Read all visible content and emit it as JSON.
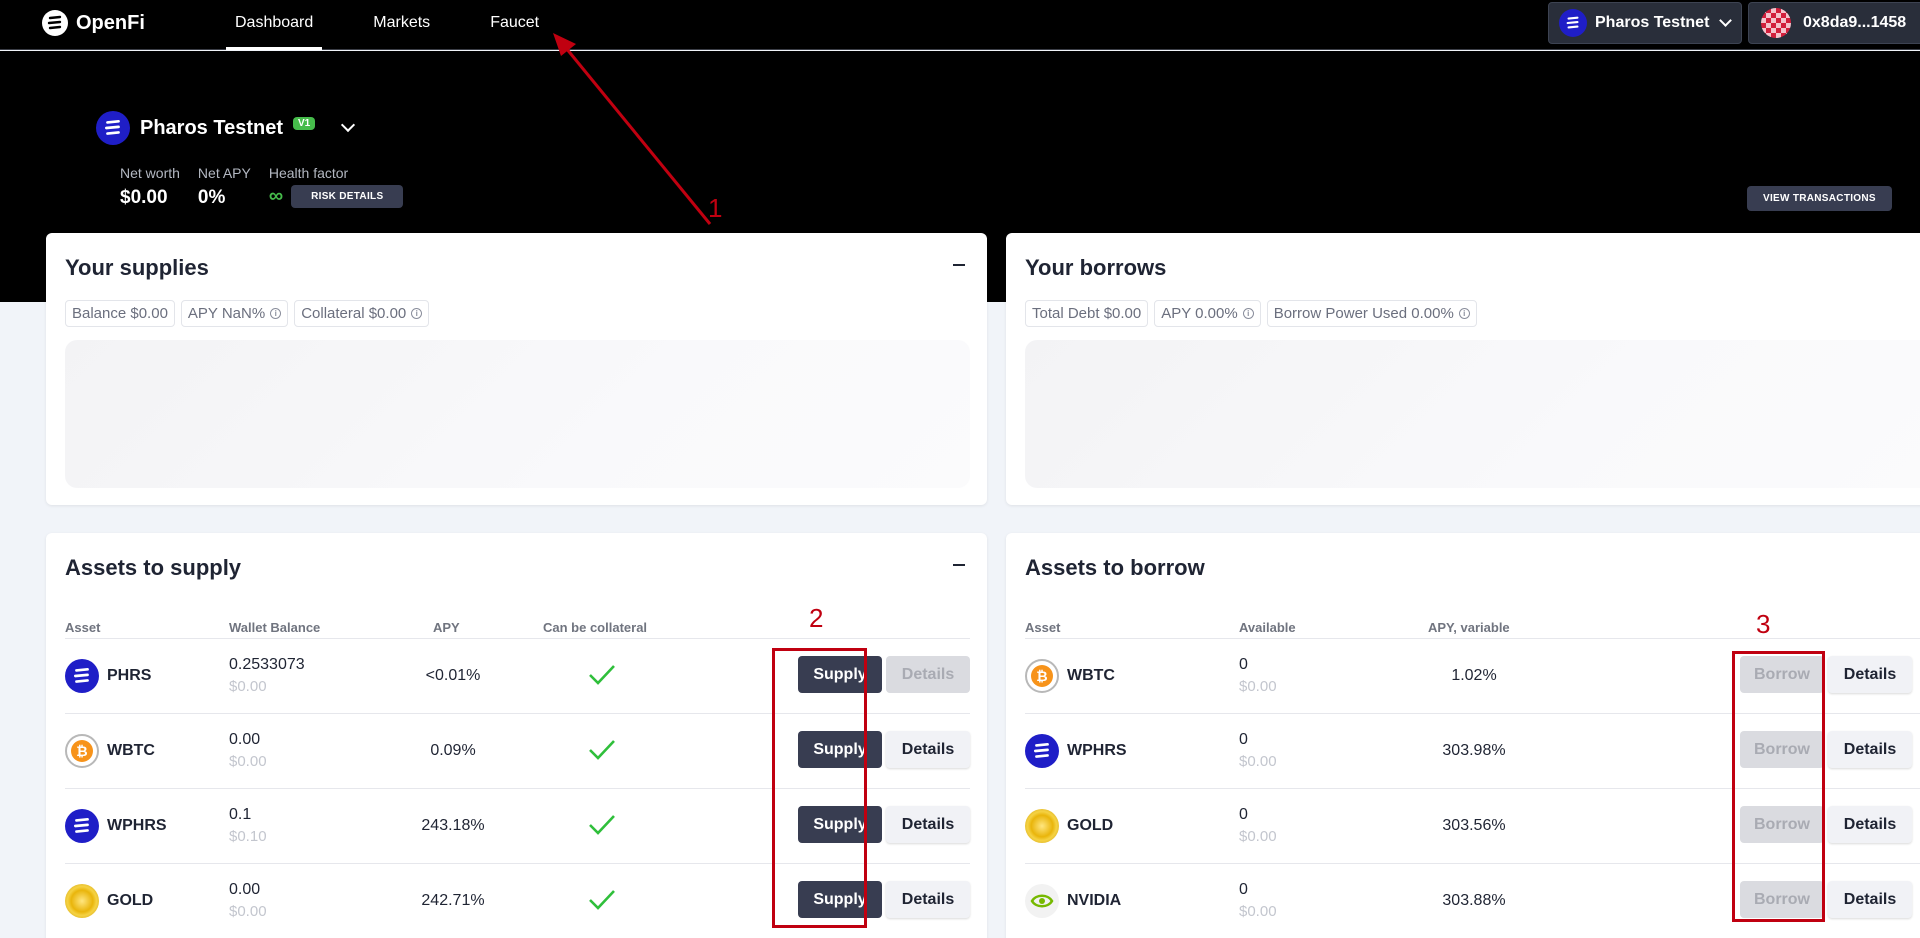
{
  "app": {
    "name": "OpenFi"
  },
  "nav": {
    "dashboard": "Dashboard",
    "markets": "Markets",
    "faucet": "Faucet"
  },
  "header": {
    "network": "Pharos Testnet",
    "wallet": "0x8da9...1458"
  },
  "hero": {
    "network": "Pharos Testnet",
    "version": "V1",
    "net_worth_label": "Net worth",
    "net_worth": "$0.00",
    "net_apy_label": "Net APY",
    "net_apy": "0%",
    "health_label": "Health factor",
    "health_value": "∞",
    "risk_button": "RISK DETAILS",
    "view_transactions": "VIEW TRANSACTIONS"
  },
  "supplies": {
    "title": "Your supplies",
    "chips": [
      "Balance $0.00",
      "APY NaN%",
      "Collateral $0.00"
    ]
  },
  "borrows": {
    "title": "Your borrows",
    "chips": [
      "Total Debt $0.00",
      "APY 0.00%",
      "Borrow Power Used 0.00%"
    ]
  },
  "assets_supply": {
    "title": "Assets to supply",
    "headers": {
      "asset": "Asset",
      "balance": "Wallet Balance",
      "apy": "APY",
      "collateral": "Can be collateral"
    },
    "supply_label": "Supply",
    "details_label": "Details",
    "rows": [
      {
        "asset": "PHRS",
        "balance": "0.2533073",
        "usd": "$0.00",
        "apy": "<0.01%"
      },
      {
        "asset": "WBTC",
        "balance": "0.00",
        "usd": "$0.00",
        "apy": "0.09%"
      },
      {
        "asset": "WPHRS",
        "balance": "0.1",
        "usd": "$0.10",
        "apy": "243.18%"
      },
      {
        "asset": "GOLD",
        "balance": "0.00",
        "usd": "$0.00",
        "apy": "242.71%"
      }
    ]
  },
  "assets_borrow": {
    "title": "Assets to borrow",
    "headers": {
      "asset": "Asset",
      "available": "Available",
      "apy": "APY, variable"
    },
    "borrow_label": "Borrow",
    "details_label": "Details",
    "rows": [
      {
        "asset": "WBTC",
        "available": "0",
        "usd": "$0.00",
        "apy": "1.02%"
      },
      {
        "asset": "WPHRS",
        "available": "0",
        "usd": "$0.00",
        "apy": "303.98%"
      },
      {
        "asset": "GOLD",
        "available": "0",
        "usd": "$0.00",
        "apy": "303.56%"
      },
      {
        "asset": "NVIDIA",
        "available": "0",
        "usd": "$0.00",
        "apy": "303.88%"
      }
    ]
  },
  "annotations": [
    "1",
    "2",
    "3"
  ],
  "colors": {
    "annotation_red": "#c00010",
    "dark_button": "#383d51",
    "accent_green": "#46bc4b",
    "token_blue": "#1f1ec7"
  }
}
